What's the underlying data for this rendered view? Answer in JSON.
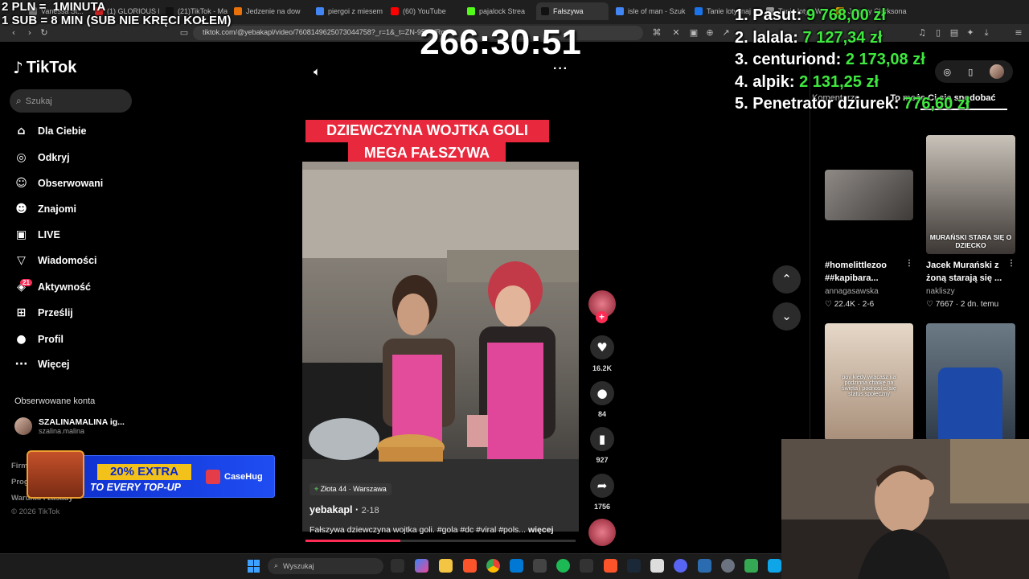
{
  "browser": {
    "tabs": [
      {
        "label": "Vanessa St...",
        "color": "#777"
      },
      {
        "label": "(1) GLORIOUS K",
        "color": "#cc2222"
      },
      {
        "label": "(21)TikTok - Make",
        "color": "#111"
      },
      {
        "label": "Jedzenie na dow",
        "color": "#e8710a"
      },
      {
        "label": "piergoi z miesem",
        "color": "#4285f4"
      },
      {
        "label": "(60) YouTube",
        "color": "#ff0000"
      },
      {
        "label": "pajalock Strea",
        "color": "#53fc18"
      },
      {
        "label": "Fałszywa",
        "color": "#111"
      },
      {
        "label": "isle of man - Szuk",
        "color": "#4285f4"
      },
      {
        "label": "Tanie loty: naj",
        "color": "#1a73e8"
      },
      {
        "label": "Tanie loty - W",
        "color": "#999"
      },
      {
        "label": "Jeremy Clarksona",
        "color": "#f4b400"
      }
    ],
    "url": "tiktok.com/@yebakapl/video/7608149625073044758?_r=1&_t=ZN-95kWRqy9a"
  },
  "overlay": {
    "rate_line1": "2 PLN =  1MINUTA",
    "rate_line2": "1 SUB = 8 MIN (SUB NIE KRĘCI KOŁEM)",
    "timer": "266:30:51",
    "leaderboard": [
      {
        "rank": "1.",
        "name": "Pasut:",
        "amount": "9 768,00 zł"
      },
      {
        "rank": "2.",
        "name": "lalala:",
        "amount": "7 127,34 zł"
      },
      {
        "rank": "3.",
        "name": "centuriond:",
        "amount": "2 173,08 zł"
      },
      {
        "rank": "4.",
        "name": "alpik:",
        "amount": "2 131,25 zł"
      },
      {
        "rank": "5.",
        "name": "Penetrator dziurek:",
        "amount": "776,60 zł"
      }
    ],
    "amount_color": "#3ee83e"
  },
  "tiktok": {
    "logo": "TikTok",
    "search_placeholder": "Szukaj",
    "nav": [
      {
        "label": "Dla Ciebie",
        "icon": "home-icon"
      },
      {
        "label": "Odkryj",
        "icon": "compass-icon"
      },
      {
        "label": "Obserwowani",
        "icon": "following-icon"
      },
      {
        "label": "Znajomi",
        "icon": "friends-icon"
      },
      {
        "label": "LIVE",
        "icon": "live-icon"
      },
      {
        "label": "Wiadomości",
        "icon": "messages-icon"
      },
      {
        "label": "Aktywność",
        "icon": "activity-icon"
      },
      {
        "label": "Prześlij",
        "icon": "upload-icon"
      },
      {
        "label": "Profil",
        "icon": "profile-icon"
      },
      {
        "label": "Więcej",
        "icon": "more-icon"
      }
    ],
    "activity_badge": "21",
    "followed_heading": "Obserwowane konta",
    "followed_account": {
      "name": "SZALINAMALINA ig...",
      "handle": "szalina.malina"
    },
    "footer": [
      "Firma",
      "Program",
      "Warunki i zasady"
    ],
    "copyright": "© 2026 TikTok",
    "ad": {
      "line1": "20% EXTRA",
      "line2": "TO EVERY TOP-UP",
      "brand": "CaseHug"
    },
    "video": {
      "caption_line1": "DZIEWCZYNA WOJTKA GOLI",
      "caption_line2": "MEGA FAŁSZYWA",
      "location": "Złota 44 · Warszawa",
      "author": "yebakapl",
      "date": "2-18",
      "description": "Fałszywa dziewczyna wojtka goli. #gola #dc #viral #pols...",
      "more": "więcej",
      "progress": 0.35
    },
    "actions": {
      "likes": "16.2K",
      "comments": "84",
      "saves": "927",
      "shares": "1756"
    },
    "right_tabs": [
      "Komentarze",
      "To może Ci się spodobać"
    ],
    "recommended": [
      {
        "title": "#homelittlezoo ##kapibara...",
        "author": "annagasawska",
        "stat": "22.4K",
        "date": "2-6"
      },
      {
        "title": "Jacek Murański z żoną starają się ...",
        "author": "nakliszy",
        "stat": "7667",
        "date": "2 dn. temu",
        "thumb_caption": "MURAŃSKI STARA SIĘ O DZIECKO"
      },
      {
        "thumb_caption": "pov kiedy wracasz na podzinna chatkę na święta i podnosi ci się status społeczny"
      },
      {
        "thumb_caption": ""
      }
    ]
  },
  "taskbar": {
    "search": "Wyszukaj"
  }
}
